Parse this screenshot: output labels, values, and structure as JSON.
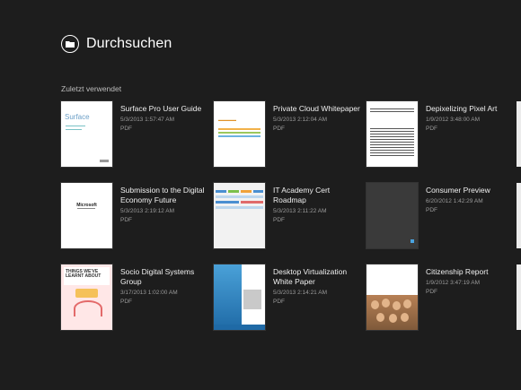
{
  "header": {
    "title": "Durchsuchen",
    "back_icon": "folder-back-icon"
  },
  "section": {
    "label": "Zuletzt verwendet"
  },
  "items": [
    {
      "name": "Surface Pro User Guide",
      "date": "5/3/2013 1:57:47 AM",
      "type": "PDF",
      "thumb": "surface"
    },
    {
      "name": "Private Cloud Whitepaper",
      "date": "5/3/2013 2:12:04 AM",
      "type": "PDF",
      "thumb": "cloud"
    },
    {
      "name": "Depixelizing Pixel Art",
      "date": "1/9/2012 3:48:00 AM",
      "type": "PDF",
      "thumb": "pixel"
    },
    {
      "name": "Submission to the Digital Economy Future",
      "date": "5/3/2013 2:19:12 AM",
      "type": "PDF",
      "thumb": "submission"
    },
    {
      "name": "IT Academy Cert Roadmap",
      "date": "5/3/2013 2:11:22 AM",
      "type": "PDF",
      "thumb": "itacademy"
    },
    {
      "name": "Consumer Preview",
      "date": "6/20/2012 1:42:29 AM",
      "type": "PDF",
      "thumb": "consumer"
    },
    {
      "name": "Socio Digital Systems Group",
      "date": "3/17/2013 1:02:00 AM",
      "type": "PDF",
      "thumb": "socio"
    },
    {
      "name": "Desktop Virtualization White Paper",
      "date": "5/3/2013 2:14:21 AM",
      "type": "PDF",
      "thumb": "desktop"
    },
    {
      "name": "Citizenship Report",
      "date": "1/9/2012 3:47:19 AM",
      "type": "PDF",
      "thumb": "citizenship"
    }
  ],
  "thumb_text": {
    "surface_brand": "Surface",
    "submission_word": "Microsoft",
    "socio_head": "THINGS WE'VE LEARNT ABOUT"
  },
  "colors": {
    "background": "#1d1d1d",
    "text": "#f0f0f0",
    "meta_text": "#9a9a9a"
  }
}
